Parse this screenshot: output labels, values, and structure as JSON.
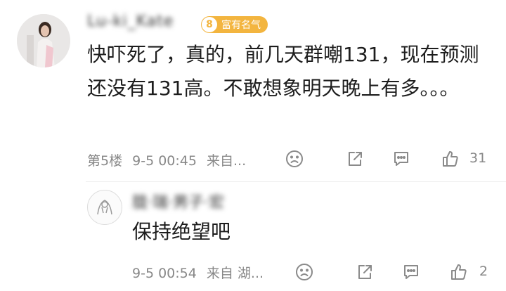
{
  "main_comment": {
    "username": "Lu-ki_Kate",
    "level": "8",
    "badge_label": "富有名气",
    "text": "快吓死了，真的，前几天群嘲131，现在预测还没有131高。不敢想象明天晚上有多。。。",
    "floor": "第5楼",
    "time": "9-5 00:45",
    "source": "来自...",
    "like_count": "31"
  },
  "reply": {
    "username": "胧·瑞·男子·宏",
    "text": "保持绝望吧",
    "time": "9-5 00:54",
    "source": "来自 湖...",
    "like_count": "2"
  },
  "icons": {
    "dislike": "frown-face-icon",
    "share": "share-icon",
    "reply": "comment-bubble-icon",
    "like": "thumbs-up-icon"
  },
  "colors": {
    "badge": "#f3b53f",
    "meta_text": "#888888",
    "body_text": "#1d1d1d"
  }
}
